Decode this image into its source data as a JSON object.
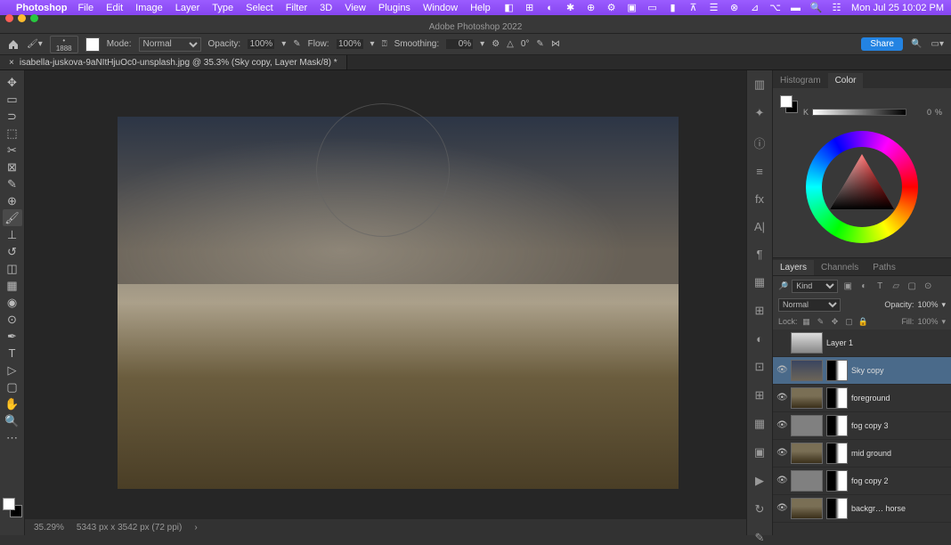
{
  "menubar": {
    "app": "Photoshop",
    "items": [
      "File",
      "Edit",
      "Image",
      "Layer",
      "Type",
      "Select",
      "Filter",
      "3D",
      "View",
      "Plugins",
      "Window",
      "Help"
    ],
    "clock": "Mon Jul 25  10:02 PM"
  },
  "window": {
    "title": "Adobe Photoshop 2022"
  },
  "optbar": {
    "brush_size": "1888",
    "mode_label": "Mode:",
    "mode": "Normal",
    "opacity_label": "Opacity:",
    "opacity": "100%",
    "flow_label": "Flow:",
    "flow": "100%",
    "smoothing_label": "Smoothing:",
    "smoothing": "0%",
    "angle_label": "△",
    "angle": "0°",
    "share": "Share"
  },
  "tab": {
    "label": "isabella-juskova-9aNItHjuOc0-unsplash.jpg @ 35.3% (Sky copy, Layer Mask/8) *"
  },
  "status": {
    "zoom": "35.29%",
    "dims": "5343 px x 3542 px (72 ppi)"
  },
  "panels": {
    "tabs_top": [
      "Histogram",
      "Color"
    ],
    "color": {
      "k_label": "K",
      "k_value": "0",
      "k_unit": "%"
    },
    "tabs_layers": [
      "Layers",
      "Channels",
      "Paths"
    ],
    "layers": {
      "filter": "Kind",
      "blend": "Normal",
      "opacity_label": "Opacity:",
      "opacity": "100%",
      "lock_label": "Lock:",
      "fill_label": "Fill:",
      "fill": "100%",
      "items": [
        {
          "name": "Layer 1",
          "eye": "",
          "mask": false,
          "cls": "cloud"
        },
        {
          "name": "Sky copy",
          "eye": "👁",
          "mask": true,
          "sel": true,
          "cls": "sky"
        },
        {
          "name": "foreground",
          "eye": "👁",
          "mask": true,
          "cls": "fg"
        },
        {
          "name": "fog copy 3",
          "eye": "👁",
          "mask": true,
          "cls": "grey"
        },
        {
          "name": "mid ground",
          "eye": "👁",
          "mask": true,
          "cls": "fg"
        },
        {
          "name": "fog copy 2",
          "eye": "👁",
          "mask": true,
          "cls": "grey"
        },
        {
          "name": "backgr… horse",
          "eye": "👁",
          "mask": true,
          "cls": "fg"
        }
      ]
    }
  }
}
